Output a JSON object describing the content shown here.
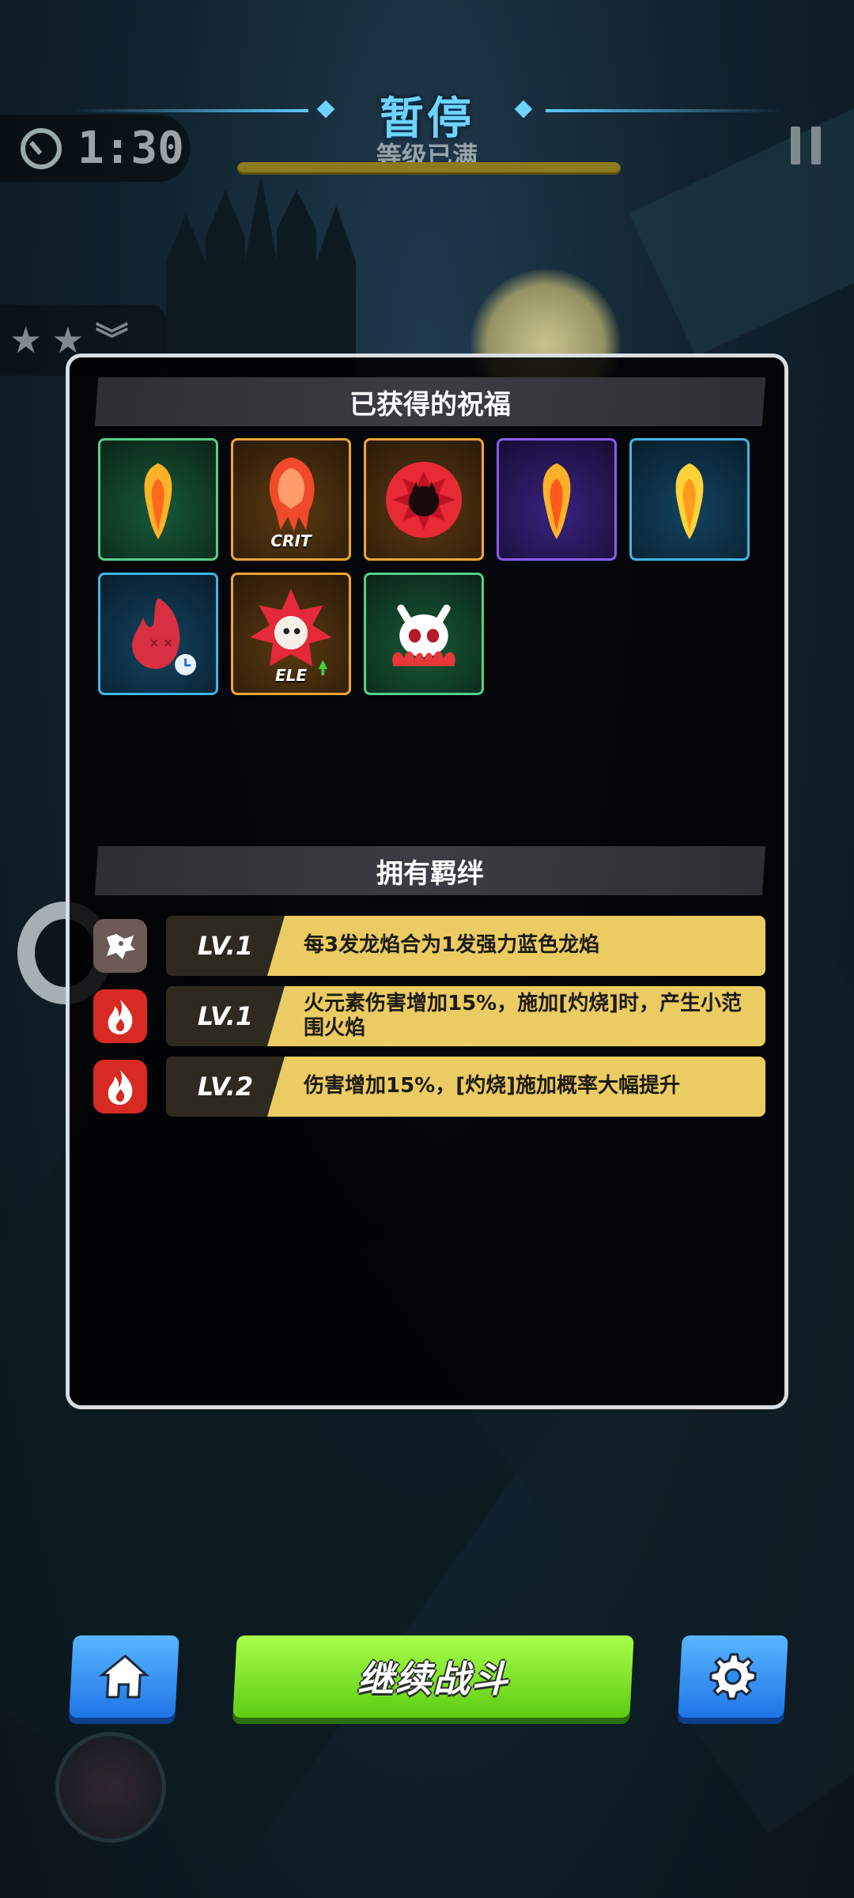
{
  "hud": {
    "title": "暂停",
    "subtitle": "等级已满",
    "timer": "1:30",
    "icons": {
      "clock": "clock-icon",
      "pause": "pause-icon",
      "stars": "star-icon",
      "chevron": "double-chevron-down-icon"
    }
  },
  "panel": {
    "blessings_title": "已获得的祝福",
    "blessings": [
      {
        "icon": "fire-bolt-icon",
        "rarity": "green",
        "tag": ""
      },
      {
        "icon": "fire-crit-icon",
        "rarity": "orange",
        "tag": "CRIT"
      },
      {
        "icon": "demon-burst-icon",
        "rarity": "orange",
        "tag": ""
      },
      {
        "icon": "fire-bolt-icon",
        "rarity": "purple",
        "tag": ""
      },
      {
        "icon": "fire-bolt-icon",
        "rarity": "blue",
        "tag": ""
      },
      {
        "icon": "fire-spirit-timer-icon",
        "rarity": "blue",
        "tag": ""
      },
      {
        "icon": "element-up-icon",
        "rarity": "orange",
        "tag": "ELE"
      },
      {
        "icon": "fire-demon-skull-icon",
        "rarity": "green",
        "tag": ""
      }
    ],
    "bonds_title": "拥有羁绊",
    "bonds": [
      {
        "icon": "dragon-skull-icon",
        "level": "LV.1",
        "desc": "每3发龙焰合为1发强力蓝色龙焰"
      },
      {
        "icon": "flame-icon",
        "level": "LV.1",
        "desc": "火元素伤害增加15%，施加[灼烧]时，产生小范围火焰"
      },
      {
        "icon": "flame-icon",
        "level": "LV.2",
        "desc": "伤害增加15%，[灼烧]施加概率大幅提升"
      }
    ]
  },
  "buttons": {
    "home_icon": "home-icon",
    "continue_label": "继续战斗",
    "settings_icon": "gear-icon"
  },
  "colors": {
    "title": "#6fd3ff",
    "continue_button": "#7ee02a",
    "side_buttons": "#2f8cf0",
    "bond_desc_bg": "#ebcc63"
  }
}
